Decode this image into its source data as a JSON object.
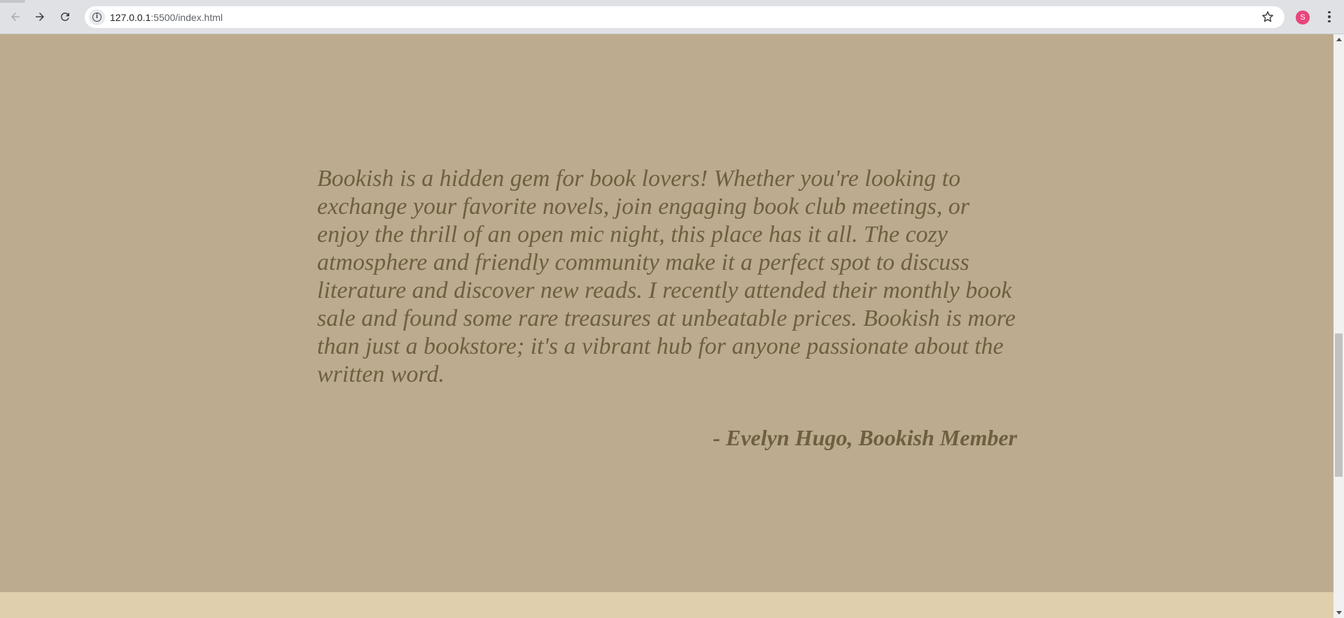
{
  "browser": {
    "url_host": "127.0.0.1",
    "url_path": ":5500/index.html",
    "profile_initial": "S",
    "icons": {
      "back": "arrow-left-icon",
      "forward": "arrow-right-icon",
      "reload": "reload-icon",
      "site_info": "info-icon",
      "bookmark": "star-icon",
      "menu": "kebab-menu-icon"
    },
    "colors": {
      "profile_avatar": "#e8457b"
    }
  },
  "page": {
    "testimonial": {
      "quote": "Bookish is a hidden gem for book lovers! Whether you're looking to exchange your favorite novels, join engaging book club meetings, or enjoy the thrill of an open mic night, this place has it all. The cozy atmosphere and friendly community make it a perfect spot to discuss literature and discover new reads. I recently attended their monthly book sale and found some rare treasures at unbeatable prices. Bookish is more than just a bookstore; it's a vibrant hub for anyone passionate about the written word.",
      "author": "- Evelyn Hugo, Bookish Member"
    },
    "colors": {
      "section_background": "#bcab8e",
      "text": "#6e5f40",
      "next_section_background": "#dfcfac"
    }
  }
}
